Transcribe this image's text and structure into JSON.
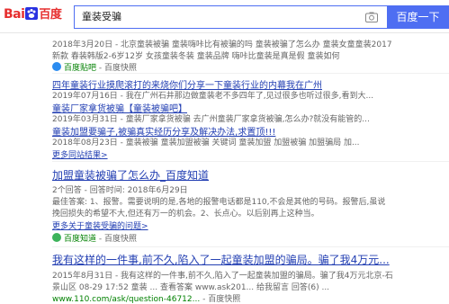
{
  "header": {
    "logo_bai": "Bai",
    "logo_du": "百度",
    "search_value": "童装受骗",
    "search_button": "百度一下"
  },
  "results": {
    "r0_snippet_1": "2018年3月20日 - 北京童装被骗 童装嗨咔比有被骗的吗 童装被骗了怎么办 童装女童童装2017",
    "r0_snippet_2": "新款 春装韩版2-6岁12岁 女孩童装冬装 童装品牌 嗨咔比童装是真是假 童装如何",
    "r0_source": "百度贴吧",
    "r0_snapshot": "百度快照",
    "r1_title": "四年童装行业摸爬滚打的来烧你们分享一下童装行业的内幕我在广州",
    "r1_snippet": "2019年07月16日 - 我在广州石井那边做童装老不多四年了,见过很多也听过很多,看到大...",
    "r2_title": "童装厂家拿货被骗【童装被骗吧】",
    "r2_snippet": "2019年03月31日 - 童装厂家拿货被骗 去广州童装厂家拿货被骗,怎么办?就没有能管的...",
    "r3_title": "童装加盟要骗子,被骗真实经历分享及解决办法,求置顶!!!",
    "r3_snippet": "2018年08月23日 - 童装被骗 童装加盟被骗 关键词 童装加盟 加盟被骗 加盟骗局 加...",
    "r3_more": "更多同站结果>",
    "r4_title": "加盟童装被骗了怎么办_百度知道",
    "r4_meta": "2个回答 - 回答时间: 2018年6月29日",
    "r4_snippet_1": "最佳答案: 1、报警。需要说明的是,各地的报警电话都是110,不会是其他的号码。报警后,虽说",
    "r4_snippet_2": "挽回损失的希望不大,但还有万一的机会。2、长点心。以后别再上这种当。",
    "r4_more": "更多关于童装受骗的问题>",
    "r4_source": "百度知道",
    "r4_snapshot": "百度快照",
    "r5_title": "我有这样的一件事,前不久,陷入了一起童装加盟的骗局。骗了我4万元...",
    "r5_snippet_1": "2015年8月31日 - 我有这样的一件事,前不久,陷入了一起童装加盟的骗局。骗了我4万元北京-石",
    "r5_snippet_2": "景山区 08-29 17:52 童装 ... 查看答案 www.ask201... 给我留言 回答(6) ...",
    "r5_url": "www.110.com/ask/question-46712...",
    "r5_snapshot": "百度快照"
  }
}
